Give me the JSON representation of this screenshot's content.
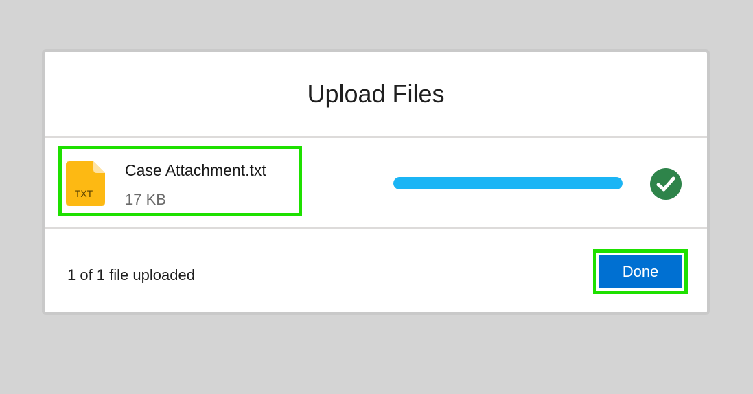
{
  "dialog": {
    "title": "Upload Files"
  },
  "file": {
    "icon": "txt-file-icon",
    "icon_label": "TXT",
    "icon_color": "#fdb913",
    "name": "Case Attachment.txt",
    "size": "17 KB",
    "progress": 1.0,
    "progress_color": "#1bb5f5",
    "status_icon": "check-circle-icon",
    "status_color": "#2e844a"
  },
  "footer": {
    "status": "1 of 1 file uploaded",
    "done_label": "Done",
    "done_color": "#0070d2"
  },
  "highlight_color": "#1ee000"
}
